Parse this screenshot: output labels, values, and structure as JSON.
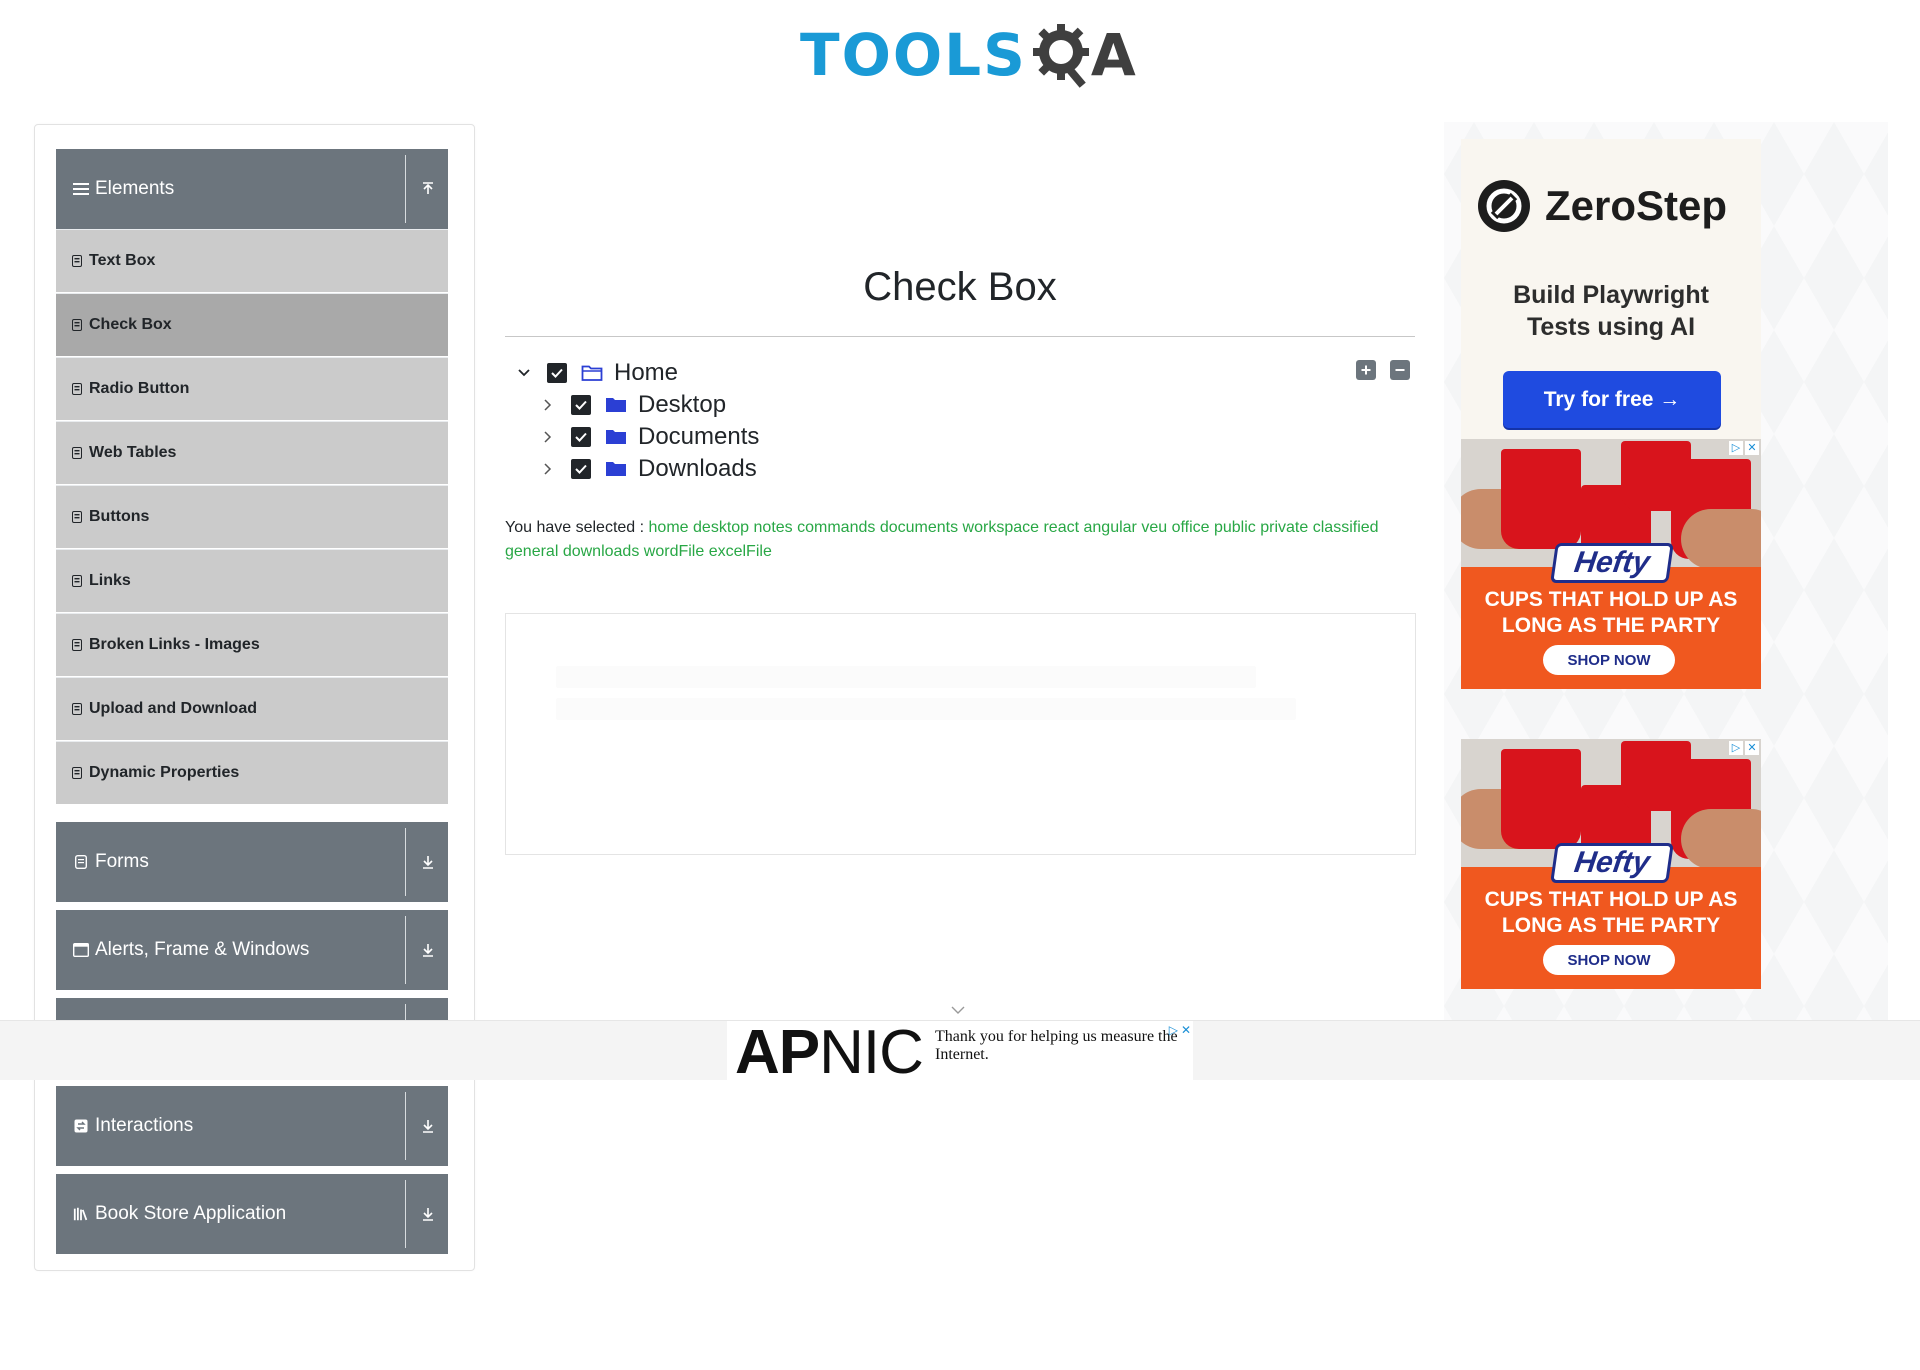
{
  "header": {
    "logo_text": "TOOLS",
    "logo_qa": "A"
  },
  "sidebar": {
    "groups": [
      {
        "label": "Elements",
        "icon": "hamburger-icon",
        "state": "expanded"
      },
      {
        "label": "Forms",
        "icon": "form-icon",
        "state": "collapsed"
      },
      {
        "label": "Alerts, Frame & Windows",
        "icon": "window-icon",
        "state": "collapsed"
      },
      {
        "label": "",
        "icon": "",
        "state": "collapsed"
      },
      {
        "label": "Interactions",
        "icon": "interactions-icon",
        "state": "collapsed"
      },
      {
        "label": "Book Store Application",
        "icon": "books-icon",
        "state": "collapsed"
      }
    ],
    "items": [
      {
        "label": "Text Box"
      },
      {
        "label": "Check Box",
        "active": true
      },
      {
        "label": "Radio Button"
      },
      {
        "label": "Web Tables"
      },
      {
        "label": "Buttons"
      },
      {
        "label": "Links"
      },
      {
        "label": "Broken Links - Images"
      },
      {
        "label": "Upload and Download"
      },
      {
        "label": "Dynamic Properties"
      }
    ]
  },
  "main": {
    "title": "Check Box",
    "tree": [
      {
        "label": "Home",
        "checked": true,
        "expanded": true,
        "level": 0
      },
      {
        "label": "Desktop",
        "checked": true,
        "expanded": false,
        "level": 1
      },
      {
        "label": "Documents",
        "checked": true,
        "expanded": false,
        "level": 1
      },
      {
        "label": "Downloads",
        "checked": true,
        "expanded": false,
        "level": 1
      }
    ],
    "expand_all_label": "+",
    "collapse_all_label": "−",
    "result_prefix": "You have selected :",
    "selected": [
      "home",
      "desktop",
      "notes",
      "commands",
      "documents",
      "workspace",
      "react",
      "angular",
      "veu",
      "office",
      "public",
      "private",
      "classified",
      "general",
      "downloads",
      "wordFile",
      "excelFile"
    ]
  },
  "ads": {
    "zerostep": {
      "name": "ZeroStep",
      "tagline_1": "Build Playwright",
      "tagline_2": "Tests using AI",
      "button": "Try for free →"
    },
    "hefty": {
      "brand": "Hefty",
      "headline_1": "CUPS THAT HOLD UP AS",
      "headline_2": "LONG AS THE PARTY",
      "button": "SHOP NOW"
    },
    "sticky": {
      "brand_bold": "AP",
      "brand_thin": "NIC",
      "message": "Thank you for helping us measure the Internet."
    }
  },
  "colors": {
    "brand_blue": "#1a9ad6",
    "group_header": "#6c757d",
    "menu_item": "#cbcbcb",
    "menu_active": "#a9a9a9",
    "selected_text": "#28a745"
  }
}
